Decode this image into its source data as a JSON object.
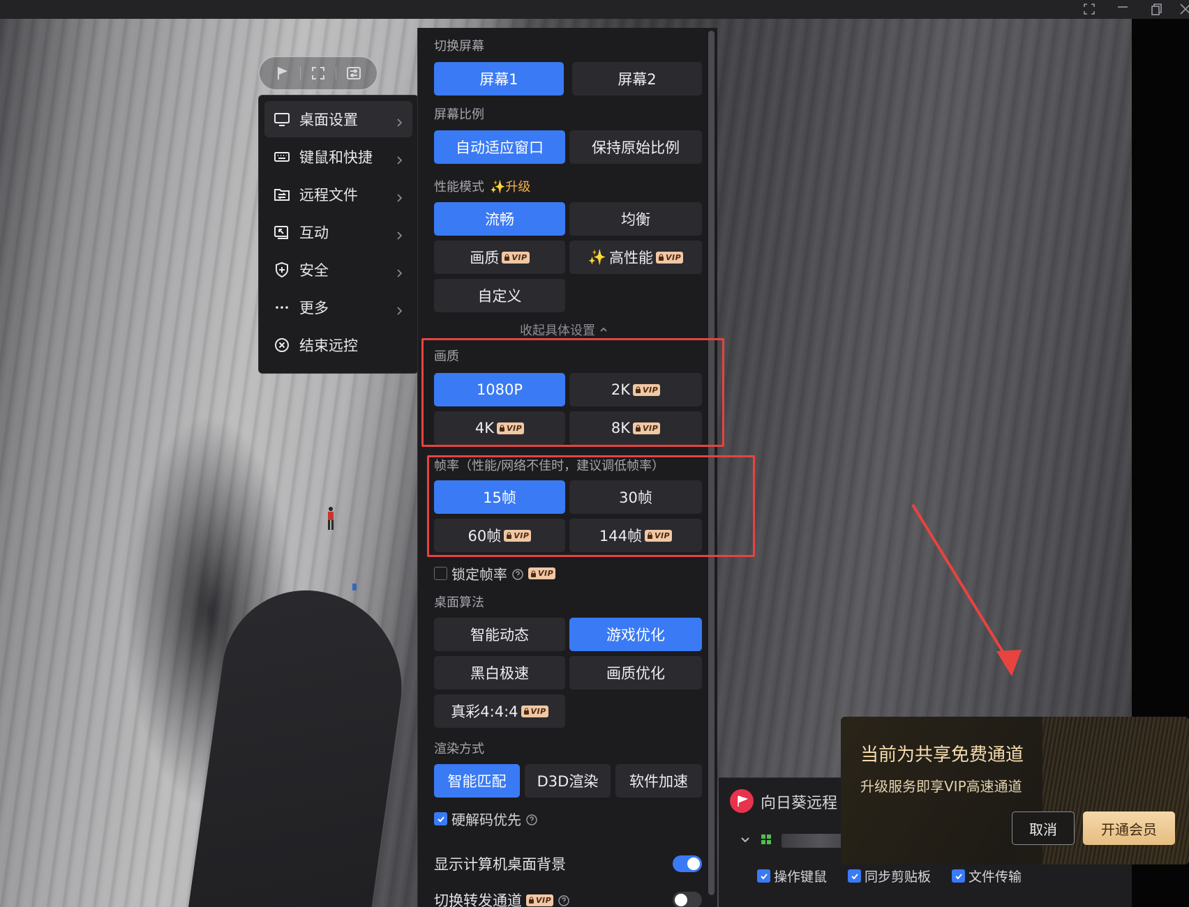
{
  "colors": {
    "accent": "#3a7af5",
    "panel_bg": "#1c1c1f",
    "button_bg": "#2b2b2f",
    "vip_badge": "#f1c7a4",
    "highlight_box": "#e8433f",
    "promo_gold": "#f3dcae"
  },
  "toolbar": {
    "icons": [
      "flag-icon",
      "fullscreen-icon",
      "settings-sliders-icon"
    ]
  },
  "menu": {
    "items": [
      {
        "label": "桌面设置",
        "icon": "monitor-icon",
        "active": true
      },
      {
        "label": "键鼠和快捷",
        "icon": "keyboard-icon"
      },
      {
        "label": "远程文件",
        "icon": "folder-transfer-icon"
      },
      {
        "label": "互动",
        "icon": "interaction-icon"
      },
      {
        "label": "安全",
        "icon": "shield-icon"
      },
      {
        "label": "更多",
        "icon": "more-icon"
      },
      {
        "label": "结束远控",
        "icon": "close-circle-icon"
      }
    ]
  },
  "panel": {
    "switch_screen": {
      "title": "切换屏幕",
      "options": [
        "屏幕1",
        "屏幕2"
      ],
      "selected": "屏幕1"
    },
    "screen_ratio": {
      "title": "屏幕比例",
      "options": [
        "自动适应窗口",
        "保持原始比例"
      ],
      "selected": "自动适应窗口"
    },
    "performance": {
      "title": "性能模式",
      "upgrade_label": "升级",
      "sparkle": "✨",
      "options": {
        "smooth": "流畅",
        "balanced": "均衡",
        "quality": "画质",
        "high_perf": "高性能",
        "custom": "自定义"
      },
      "selected": "流畅"
    },
    "collapse_label": "收起具体设置",
    "quality": {
      "title": "画质",
      "options": {
        "p1080": "1080P",
        "k2": "2K",
        "k4": "4K",
        "k8": "8K"
      },
      "selected": "1080P"
    },
    "framerate": {
      "title": "帧率（性能/网络不佳时，建议调低帧率）",
      "options": {
        "f15": "15帧",
        "f30": "30帧",
        "f60": "60帧",
        "f144": "144帧"
      },
      "selected": "15帧"
    },
    "lock_fps": {
      "label": "锁定帧率",
      "checked": false
    },
    "algorithm": {
      "title": "桌面算法",
      "options": {
        "smart": "智能动态",
        "game": "游戏优化",
        "bw": "黑白极速",
        "quality": "画质优化",
        "truecolor": "真彩4:4:4"
      },
      "selected": "游戏优化"
    },
    "render": {
      "title": "渲染方式",
      "options": {
        "smart": "智能匹配",
        "d3d": "D3D渲染",
        "soft": "软件加速"
      },
      "selected": "智能匹配"
    },
    "hw_decode": {
      "label": "硬解码优先",
      "checked": true
    },
    "show_wallpaper": {
      "label": "显示计算机桌面背景",
      "on": true
    },
    "relay_channel": {
      "label": "切换转发通道",
      "on": false
    },
    "vip_text": "VIP"
  },
  "appcard": {
    "app_name": "向日葵远程",
    "options": [
      {
        "label": "操作键鼠",
        "checked": true
      },
      {
        "label": "同步剪贴板",
        "checked": true
      },
      {
        "label": "文件传输",
        "checked": true
      }
    ]
  },
  "promo": {
    "title": "当前为共享免费通道",
    "subtitle": "升级服务即享VIP高速通道",
    "cancel": "取消",
    "confirm": "开通会员"
  }
}
